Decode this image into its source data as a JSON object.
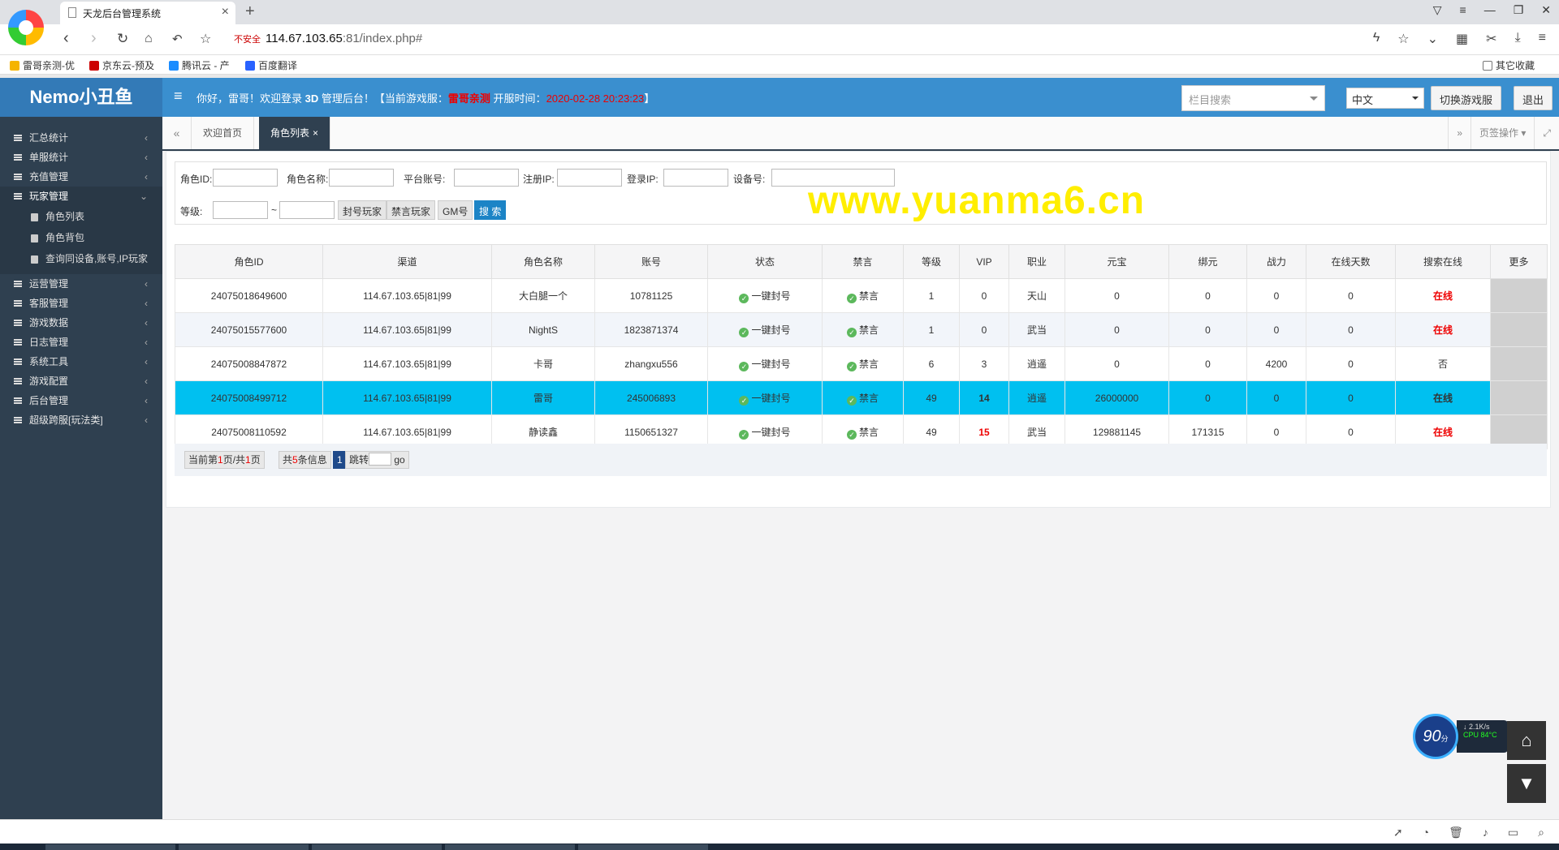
{
  "browser": {
    "tab_title": "天龙后台管理系统",
    "url_secure_label": "不安全",
    "url_host": "114.67.103.65",
    "url_path": ":81/index.php#",
    "bookmarks": [
      "雷哥亲测-优",
      "京东云-预及",
      "腾讯云 - 产",
      "百度翻译"
    ],
    "other_bookmarks": "其它收藏"
  },
  "app": {
    "logo": "Nemo小丑鱼",
    "welcome_prefix": "你好，雷哥！欢迎登录",
    "welcome_bold": "3D",
    "welcome_suffix": "管理后台！【当前游戏服：",
    "server_name": "雷哥亲测",
    "open_time_label": "开服时间：",
    "open_time": "2020-02-28 20:23:23",
    "welcome_end": "】",
    "column_search_placeholder": "栏目搜索",
    "language": "中文",
    "switch_server_label": "切换游戏服",
    "logout_label": "退出"
  },
  "sidebar": {
    "items": [
      {
        "label": "汇总统计",
        "arrow": "‹"
      },
      {
        "label": "单服统计",
        "arrow": "‹"
      },
      {
        "label": "充值管理",
        "arrow": "‹"
      },
      {
        "label": "玩家管理",
        "arrow": "⌄"
      },
      {
        "label": "运营管理",
        "arrow": "‹"
      },
      {
        "label": "客服管理",
        "arrow": "‹"
      },
      {
        "label": "游戏数据",
        "arrow": "‹"
      },
      {
        "label": "日志管理",
        "arrow": "‹"
      },
      {
        "label": "系统工具",
        "arrow": "‹"
      },
      {
        "label": "游戏配置",
        "arrow": "‹"
      },
      {
        "label": "后台管理",
        "arrow": "‹"
      },
      {
        "label": "超级跨服[玩法类]",
        "arrow": "‹"
      }
    ],
    "sub_items": [
      "角色列表",
      "角色背包",
      "查询同设备,账号,IP玩家"
    ]
  },
  "content_tabs": {
    "tabs": [
      "欢迎首页",
      "角色列表"
    ],
    "close_glyph": "×",
    "page_ops_label": "页签操作"
  },
  "filters": {
    "role_id_label": "角色ID:",
    "role_name_label": "角色名称:",
    "platform_account_label": "平台账号:",
    "register_ip_label": "注册IP:",
    "login_ip_label": "登录IP:",
    "device_label": "设备号:",
    "level_label": "等级:",
    "range_sep": "~",
    "ban_player_label": "封号玩家",
    "mute_player_label": "禁言玩家",
    "gm_label": "GM号",
    "search_label": "搜 索"
  },
  "watermark": "www.yuanma6.cn",
  "table": {
    "headers": [
      "角色ID",
      "渠道",
      "角色名称",
      "账号",
      "状态",
      "禁言",
      "等级",
      "VIP",
      "职业",
      "元宝",
      "绑元",
      "战力",
      "在线天数",
      "搜索在线",
      "更多"
    ],
    "status_text": "一键封号",
    "mute_text": "禁言",
    "rows": [
      {
        "id": "24075018649600",
        "channel": "114.67.103.65|81|99",
        "name": "大白腿一个",
        "account": "10781125",
        "level": "1",
        "vip": "0",
        "job": "天山",
        "yuanbao": "0",
        "bind": "0",
        "power": "0",
        "days": "0",
        "online": "在线"
      },
      {
        "id": "24075015577600",
        "channel": "114.67.103.65|81|99",
        "name": "NightS",
        "account": "1823871374",
        "level": "1",
        "vip": "0",
        "job": "武当",
        "yuanbao": "0",
        "bind": "0",
        "power": "0",
        "days": "0",
        "online": "在线"
      },
      {
        "id": "24075008847872",
        "channel": "114.67.103.65|81|99",
        "name": "卡哥",
        "account": "zhangxu556",
        "level": "6",
        "vip": "3",
        "job": "逍遥",
        "yuanbao": "0",
        "bind": "0",
        "power": "4200",
        "days": "0",
        "online": "否"
      },
      {
        "id": "24075008499712",
        "channel": "114.67.103.65|81|99",
        "name": "雷哥",
        "account": "245006893",
        "level": "49",
        "vip": "14",
        "job": "逍遥",
        "yuanbao": "26000000",
        "bind": "0",
        "power": "0",
        "days": "0",
        "online": "在线"
      },
      {
        "id": "24075008110592",
        "channel": "114.67.103.65|81|99",
        "name": "静读鑫",
        "account": "1150651327",
        "level": "49",
        "vip": "15",
        "job": "武当",
        "yuanbao": "129881145",
        "bind": "171315",
        "power": "0",
        "days": "0",
        "online": "在线"
      }
    ]
  },
  "pager": {
    "page_prefix": "当前第",
    "current_page": "1",
    "page_mid": "页/共",
    "total_pages": "1",
    "page_suffix": "页",
    "total_prefix": "共",
    "total_count": "5",
    "total_suffix": "条信息",
    "page_button": "1",
    "jump_label": "跳转",
    "go_label": "go"
  },
  "widget": {
    "score": "90",
    "score_unit": "分",
    "net_speed": "2.1K/s",
    "cpu": "CPU 84°C"
  }
}
